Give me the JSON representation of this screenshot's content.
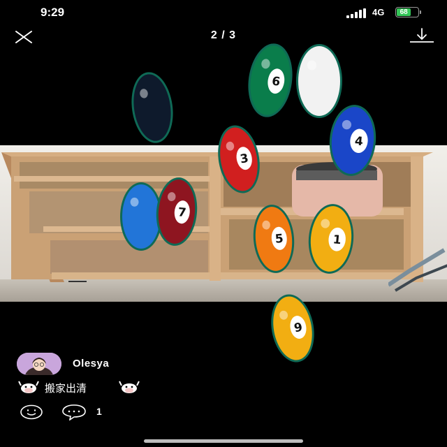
{
  "status_bar": {
    "time": "9:29",
    "network": "4G",
    "battery": "68",
    "battery_color": "#35c759"
  },
  "viewer": {
    "close_icon": "close-icon",
    "counter": "2 / 3",
    "download_icon": "download-icon"
  },
  "photo": {
    "balls": [
      {
        "number": "",
        "color": "#0e1a2c"
      },
      {
        "number": "6",
        "color": "#0a7d4b"
      },
      {
        "number": "",
        "color": "#f2f2f2"
      },
      {
        "number": "4",
        "color": "#1a46c8"
      },
      {
        "number": "3",
        "color": "#d11f1f"
      },
      {
        "number": "",
        "color": "#2275d8"
      },
      {
        "number": "7",
        "color": "#8e1520"
      },
      {
        "number": "5",
        "color": "#f07a12"
      },
      {
        "number": "1",
        "color": "#f2ae12"
      },
      {
        "number": "9",
        "color": "#f2ae12"
      }
    ]
  },
  "post": {
    "author": "Olesya",
    "caption": "搬家出清",
    "caption_emoji": "cow-face-icon",
    "comment_count": "1"
  }
}
